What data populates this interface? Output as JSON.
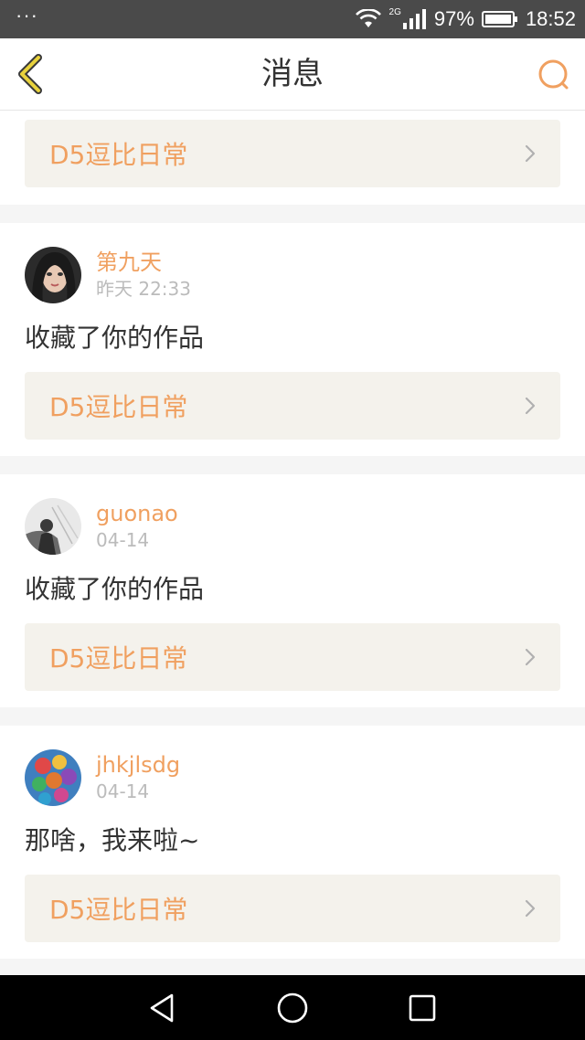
{
  "status_bar": {
    "dots": "···",
    "network": "2G",
    "battery": "97%",
    "time": "18:52"
  },
  "header": {
    "title": "消息"
  },
  "icons": {
    "back": "chevron-left-icon",
    "search": "search-icon",
    "chevron": "chevron-right-icon"
  },
  "colors": {
    "accent": "#f0a060",
    "back_icon": "#e8d23c",
    "status_bar": "#4a4a4a",
    "card_link_bg": "#f4f2ec"
  },
  "feed": {
    "first_card": {
      "work_title": "D5逗比日常"
    },
    "items": [
      {
        "username": "第九天",
        "time": "昨天 22:33",
        "message": "收藏了你的作品",
        "work_title": "D5逗比日常"
      },
      {
        "username": "guonao",
        "time": "04-14",
        "message": "收藏了你的作品",
        "work_title": "D5逗比日常"
      },
      {
        "username": "jhkjlsdg",
        "time": "04-14",
        "message": "那啥，我来啦~",
        "work_title": "D5逗比日常"
      }
    ]
  },
  "nav_bar": {
    "back": "triangle-back-icon",
    "home": "circle-home-icon",
    "recent": "square-recent-icon"
  }
}
